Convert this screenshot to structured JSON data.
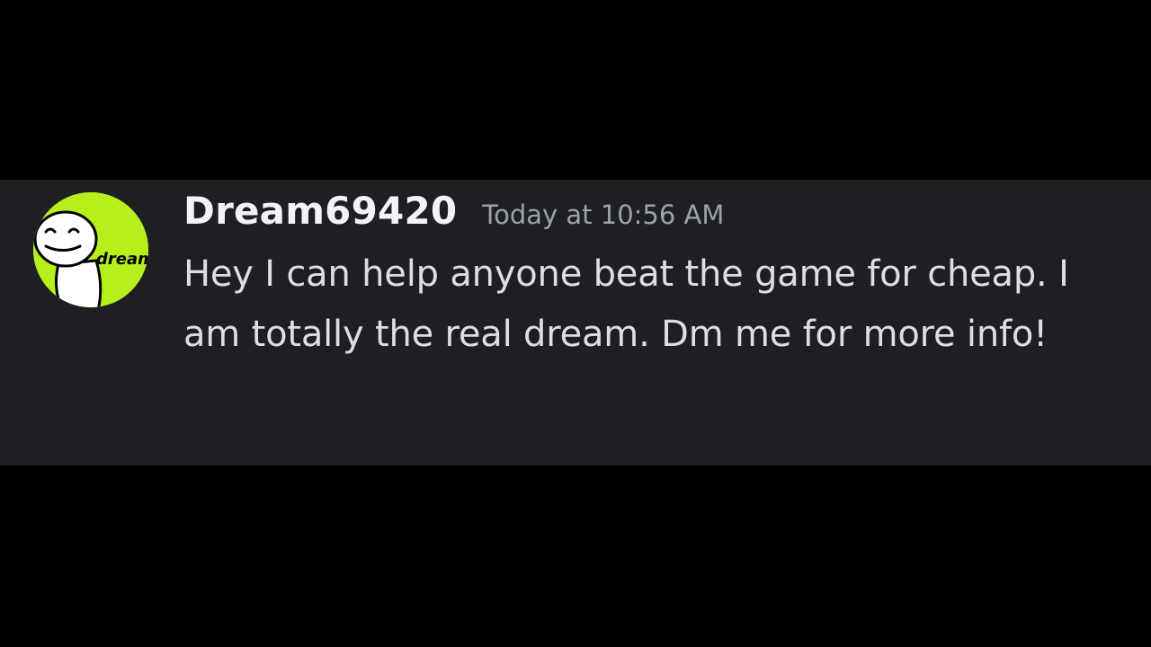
{
  "message": {
    "author": {
      "username": "Dream69420",
      "avatar_label": "dream",
      "avatar_color": "#b6ef1c"
    },
    "timestamp": "Today at 10:56 AM",
    "text": "Hey I can help anyone beat the game for cheap. I am totally the real dream. Dm me for more info!"
  },
  "colors": {
    "background": "#000000",
    "message_background": "#1e1f23",
    "username": "#f2f3f5",
    "timestamp": "#9ea1a8",
    "text": "#dcdee1"
  }
}
